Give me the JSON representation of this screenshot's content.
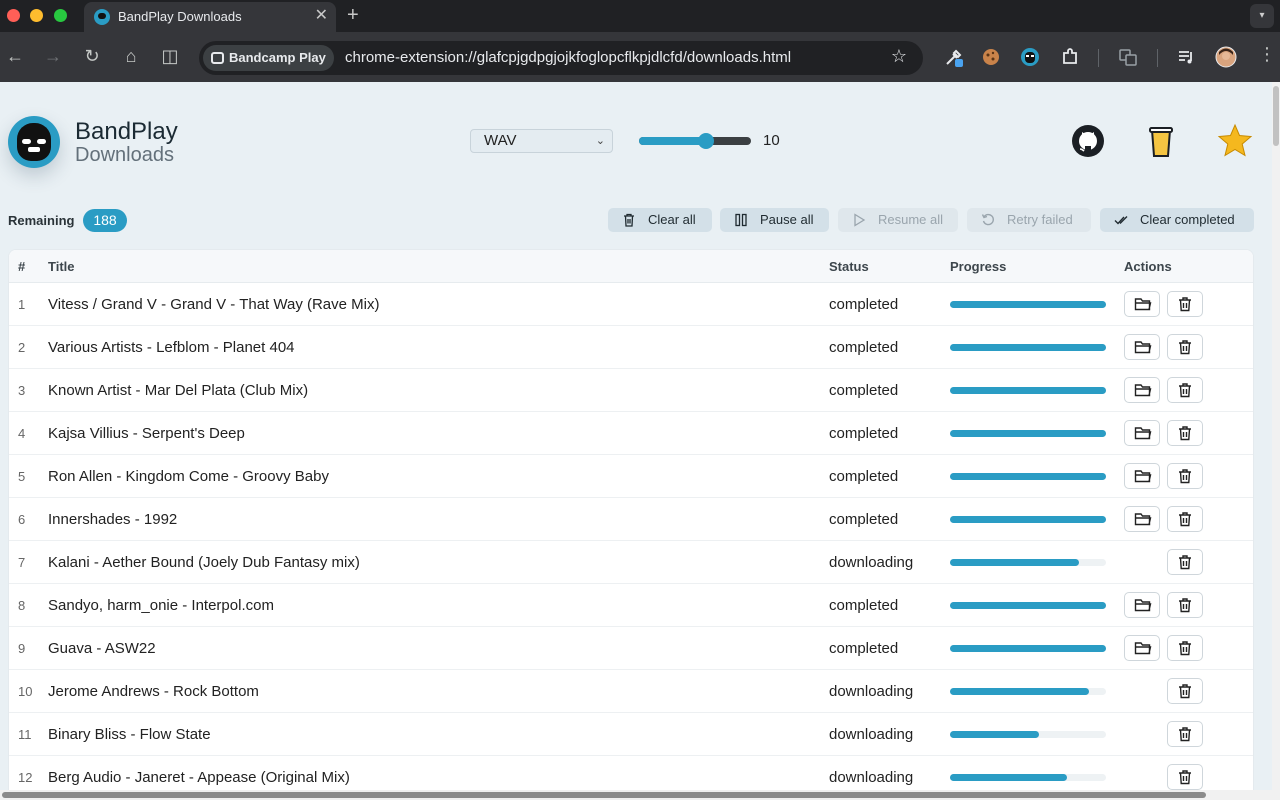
{
  "browser": {
    "tab_title": "BandPlay Downloads",
    "tab_close": "✕",
    "new_tab": "+",
    "site_chip": "Bandcamp Play",
    "url": "chrome-extension://glafcpjgdpgjojkfoglopcflkpjdlcfd/downloads.html",
    "bookmark_star": "☆",
    "nav": {
      "back": "←",
      "forward": "→",
      "reload": "↻",
      "home": "⌂",
      "split": "◫"
    }
  },
  "app": {
    "name": "BandPlay",
    "subtitle": "Downloads",
    "format": {
      "selected": "WAV"
    },
    "concurrency": {
      "value": 10,
      "display": "10",
      "min": 1,
      "max": 16
    },
    "remaining_label": "Remaining",
    "remaining_count": "188"
  },
  "actions": {
    "clear_all": "Clear all",
    "pause_all": "Pause all",
    "resume_all": "Resume all",
    "retry_failed": "Retry failed",
    "clear_completed": "Clear completed"
  },
  "table": {
    "headers": {
      "num": "#",
      "title": "Title",
      "status": "Status",
      "progress": "Progress",
      "actions": "Actions"
    },
    "rows": [
      {
        "num": "1",
        "title": "Vitess / Grand V - Grand V - That Way (Rave Mix)",
        "status": "completed",
        "progress": 1.0
      },
      {
        "num": "2",
        "title": "Various Artists - Lefblom - Planet 404",
        "status": "completed",
        "progress": 1.0
      },
      {
        "num": "3",
        "title": "Known Artist - Mar Del Plata (Club Mix)",
        "status": "completed",
        "progress": 1.0
      },
      {
        "num": "4",
        "title": "Kajsa Villius - Serpent's Deep",
        "status": "completed",
        "progress": 1.0
      },
      {
        "num": "5",
        "title": "Ron Allen - Kingdom Come - Groovy Baby",
        "status": "completed",
        "progress": 1.0
      },
      {
        "num": "6",
        "title": "Innershades - 1992",
        "status": "completed",
        "progress": 1.0
      },
      {
        "num": "7",
        "title": "Kalani - Aether Bound (Joely Dub Fantasy mix)",
        "status": "downloading",
        "progress": 0.83
      },
      {
        "num": "8",
        "title": "Sandyo, harm_onie - Interpol.com",
        "status": "completed",
        "progress": 1.0
      },
      {
        "num": "9",
        "title": "Guava - ASW22",
        "status": "completed",
        "progress": 1.0
      },
      {
        "num": "10",
        "title": "Jerome Andrews - Rock Bottom",
        "status": "downloading",
        "progress": 0.89
      },
      {
        "num": "11",
        "title": "Binary Bliss - Flow State",
        "status": "downloading",
        "progress": 0.57
      },
      {
        "num": "12",
        "title": "Berg Audio - Janeret - Appease (Original Mix)",
        "status": "downloading",
        "progress": 0.75
      }
    ]
  },
  "colors": {
    "accent": "#2a9cc4",
    "page_bg": "#e9f0f4",
    "star": "#f5b81e",
    "cup": "#f5c542"
  }
}
